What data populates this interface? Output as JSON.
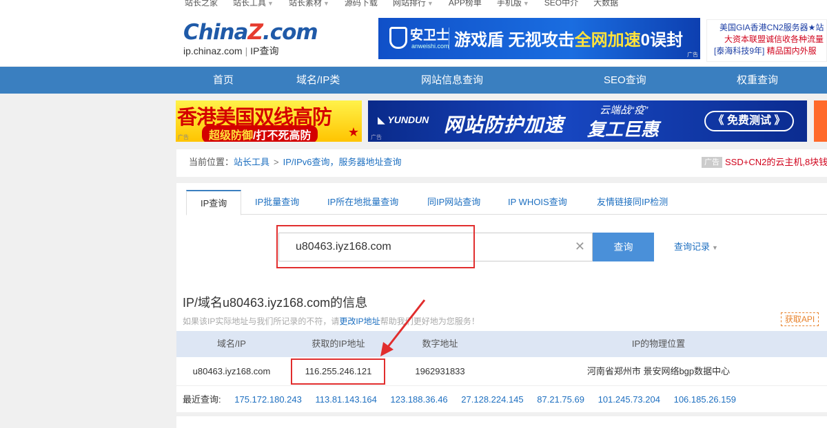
{
  "topnav": {
    "items": [
      {
        "label": "站长之家",
        "caret": false
      },
      {
        "label": "站长工具",
        "caret": true
      },
      {
        "label": "站长素材",
        "caret": true
      },
      {
        "label": "源码下载",
        "caret": false
      },
      {
        "label": "网站排行",
        "caret": true
      },
      {
        "label": "APP榜单",
        "caret": false
      },
      {
        "label": "手机版",
        "caret": true
      },
      {
        "label": "SEO中介",
        "caret": false
      },
      {
        "label": "大数据",
        "caret": false
      }
    ]
  },
  "header": {
    "logo_china": "China",
    "logo_z": "Z",
    "logo_com": ".com",
    "logo_domain": "ip.chinaz.com",
    "logo_sep": "|",
    "logo_tool": "IP查询",
    "banner": {
      "brand": "安卫士",
      "brand_en": "anweishi.com",
      "slogan_a": "游戏盾 无视攻击",
      "slogan_b": "全网加速",
      "slogan_c": "0误封",
      "adtag": "广告"
    },
    "side_ad": {
      "line1": "美国GIA香港CN2服务器★站",
      "line2": "大资本联盟诚信收各种流量",
      "line3_a": "[泰海科技9年]",
      "line3_b": " 精品国内外服"
    }
  },
  "mainnav": {
    "items": [
      "首页",
      "域名/IP类",
      "网站信息查询",
      "SEO查询",
      "权重查询"
    ]
  },
  "ads": {
    "hk_title": "香港美国双线高防",
    "hk_sub_a": "超级防御",
    "hk_sub_b": "/打不死高防",
    "adtag": "广告",
    "yd_logo": "YUNDUN",
    "yd_title": "网站防护加速",
    "yd_small": "云端战“疫”",
    "yd_big": "复工巨惠",
    "yd_btn": "《 免费测试 》"
  },
  "breadcrumb": {
    "prefix": "当前位置：",
    "link": "站长工具",
    "sep": ">",
    "current": "IP/IPv6查询，服务器地址查询",
    "ad_tag": "广告",
    "ad_text": "SSD+CN2的云主机,8块钱"
  },
  "tabs": [
    {
      "label": "IP查询",
      "active": true
    },
    {
      "label": "IP批量查询",
      "active": false
    },
    {
      "label": "IP所在地批量查询",
      "active": false
    },
    {
      "label": "同IP网站查询",
      "active": false
    },
    {
      "label": "IP WHOIS查询",
      "active": false
    },
    {
      "label": "友情链接同IP检测",
      "active": false
    }
  ],
  "search": {
    "value": "u80463.iyz168.com",
    "clear_icon": "close-icon",
    "button": "查询",
    "history": "查询记录"
  },
  "result": {
    "title": "IP/域名u80463.iyz168.com的信息",
    "hint_a": "如果该IP实际地址与我们所记录的不符，请",
    "hint_link": "更改IP地址",
    "hint_b": "帮助我们更好地为您服务！",
    "api": "获取API",
    "columns": [
      "域名/IP",
      "获取的IP地址",
      "数字地址",
      "IP的物理位置"
    ],
    "row": [
      "u80463.iyz168.com",
      "116.255.246.121",
      "1962931833",
      "河南省郑州市 景安网络bgp数据中心"
    ],
    "recent_label": "最近查询:",
    "recent_ips": [
      "175.172.180.243",
      "113.81.143.164",
      "123.188.36.46",
      "27.128.224.145",
      "87.21.75.69",
      "101.245.73.204",
      "106.185.26.159"
    ]
  },
  "colors": {
    "nav_blue": "#3a7fc0",
    "link_blue": "#1d6fc0",
    "annotation_red": "#e12d2d",
    "table_header": "#dde6f4"
  }
}
